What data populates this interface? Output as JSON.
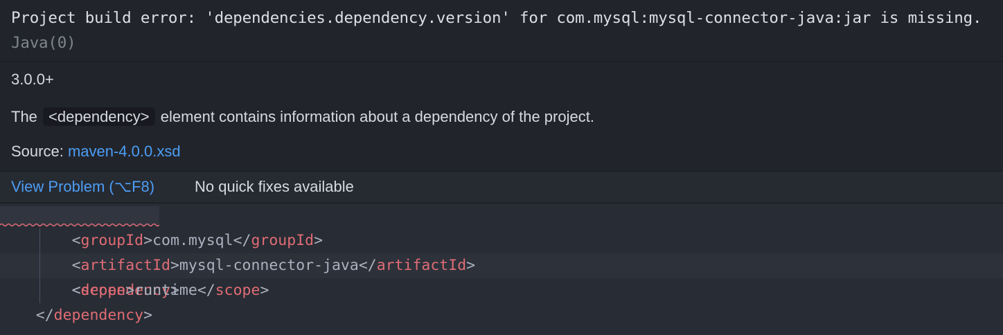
{
  "hover": {
    "message": "Project build error: 'dependencies.dependency.version' for com.mysql:mysql-connector-java:jar is missing.",
    "message_source": "Java(0)",
    "version": "3.0.0+",
    "desc_prefix": "The",
    "desc_code": "<dependency>",
    "desc_suffix": "element contains information about a dependency of the project.",
    "source_label": "Source:",
    "source_link": "maven-4.0.0.xsd"
  },
  "status": {
    "view_problem": "View Problem (⌥F8)",
    "no_fixes": "No quick fixes available"
  },
  "editor": {
    "lines": [
      {
        "indent": "    ",
        "open": "<",
        "tag": "dependency",
        "close": ">",
        "text": "",
        "end_open": "",
        "end_tag": "",
        "end_close": ""
      },
      {
        "indent": "        ",
        "open": "<",
        "tag": "groupId",
        "close": ">",
        "text": "com.mysql",
        "end_open": "</",
        "end_tag": "groupId",
        "end_close": ">"
      },
      {
        "indent": "        ",
        "open": "<",
        "tag": "artifactId",
        "close": ">",
        "text": "mysql-connector-java",
        "end_open": "</",
        "end_tag": "artifactId",
        "end_close": ">"
      },
      {
        "indent": "        ",
        "open": "<",
        "tag": "scope",
        "close": ">",
        "text": "runtime",
        "end_open": "</",
        "end_tag": "scope",
        "end_close": ">"
      },
      {
        "indent": "    ",
        "open": "</",
        "tag": "dependency",
        "close": ">",
        "text": "",
        "end_open": "",
        "end_tag": "",
        "end_close": ""
      }
    ]
  },
  "colors": {
    "tag": "#e06c75",
    "link": "#4d9df5",
    "error_squiggle": "#e06c75"
  }
}
